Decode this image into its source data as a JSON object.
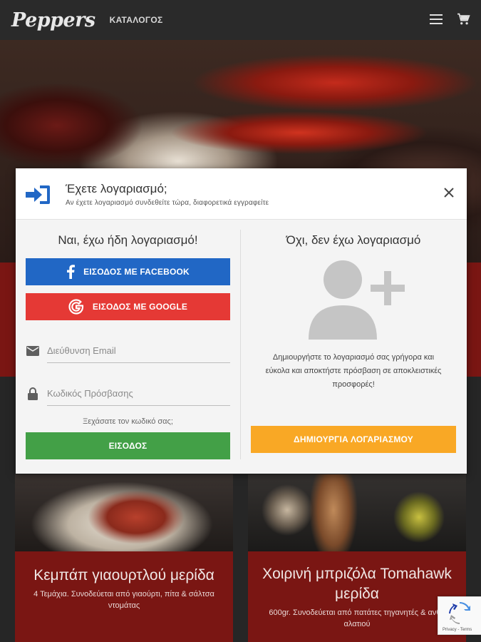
{
  "header": {
    "logo": "Peppers",
    "catalog_label": "ΚΑΤΑΛΟΓΟΣ",
    "menu_icon": "hamburger-menu-icon",
    "cart_icon": "shopping-cart-icon"
  },
  "modal": {
    "title": "Έχετε λογαριασμό;",
    "subtitle": "Αν έχετε λογαριασμό συνδεθείτε τώρα, διαφορετικά εγγραφείτε",
    "left": {
      "heading": "Ναι, έχω ήδη λογαριασμό!",
      "facebook_label": "ΕΙΣΟΔΟΣ ΜΕ FACEBOOK",
      "google_label": "ΕΙΣΟΔΟΣ ΜΕ GOOGLE",
      "email_placeholder": "Διεύθυνση Email",
      "password_placeholder": "Κωδικός Πρόσβασης",
      "forgot_label": "Ξεχάσατε τον κωδικό σας;",
      "login_label": "ΕΙΣΟΔΟΣ"
    },
    "right": {
      "heading": "Όχι, δεν έχω λογαριασμό",
      "promo": "Δημιουργήστε το λογαριασμό σας γρήγορα και εύκολα και αποκτήστε πρόσβαση σε αποκλειστικές προσφορές!",
      "create_label": "ΔΗΜΙΟΥΡΓΙΑ ΛΟΓΑΡΙΑΣΜΟΥ"
    }
  },
  "products": [
    {
      "title": "Κεμπάπ γιαουρτλού μερίδα",
      "description": "4 Τεμάχια. Συνοδεύεται από γιαούρτι, πίτα & σάλτσα ντομάτας"
    },
    {
      "title": "Χοιρινή μπριζόλα Tomahawk μερίδα",
      "description": "600gr. Συνοδεύεται από πατάτες τηγανητές & ανθό αλατιού"
    }
  ],
  "recaptcha": {
    "label": "Privacy - Terms"
  },
  "colors": {
    "facebook": "#2167c5",
    "google": "#e53935",
    "login": "#43a047",
    "create": "#f9a825",
    "brand_red": "#7a1613"
  }
}
